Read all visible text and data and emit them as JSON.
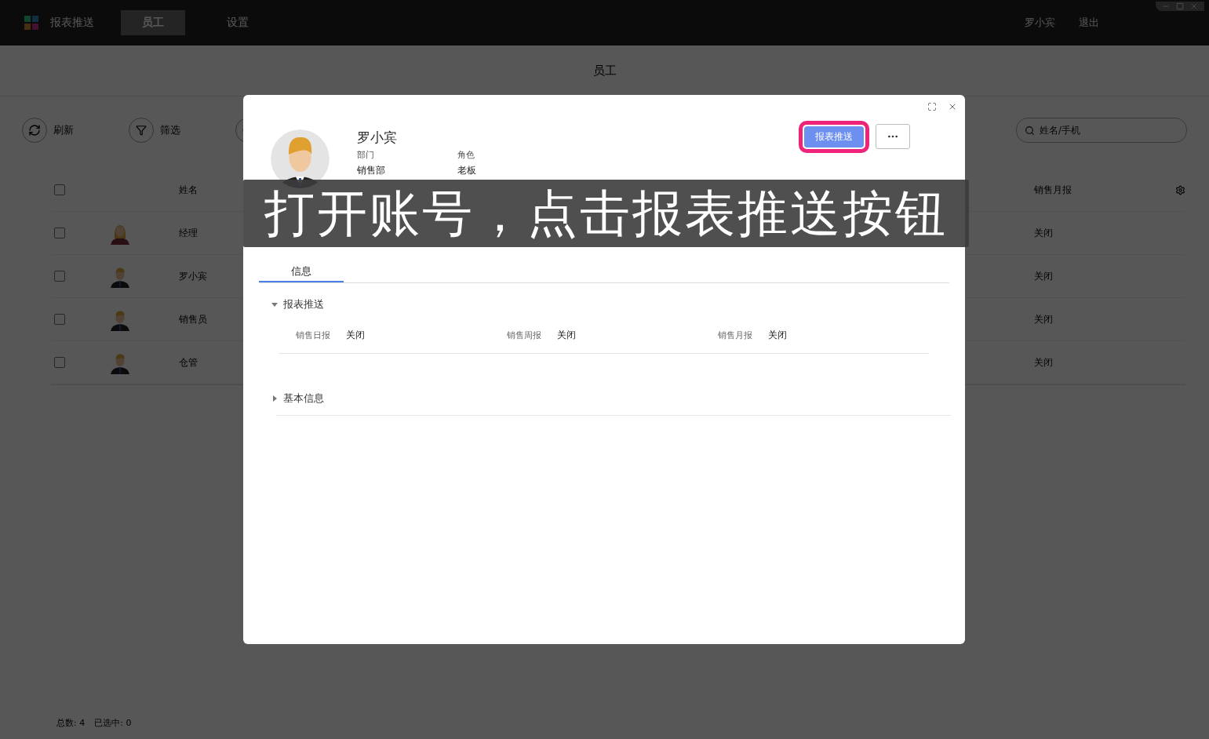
{
  "titlebar": {
    "app_name": "报表推送",
    "nav": [
      {
        "label": "员工",
        "selected": true
      },
      {
        "label": "设置",
        "selected": false
      }
    ],
    "user": "罗小宾",
    "logout": "退出"
  },
  "page_title": "员工",
  "toolbar": {
    "buttons": [
      {
        "label": "刷新",
        "kind": "refresh"
      },
      {
        "label": "筛选",
        "kind": "filter"
      }
    ],
    "search": {
      "placeholder": "姓名/手机"
    }
  },
  "table": {
    "columns": {
      "name": "姓名",
      "monthly": "销售月报"
    },
    "header_checked": false,
    "rows": [
      {
        "kind": "female",
        "name": "经理",
        "monthly": "关闭",
        "checked": false
      },
      {
        "kind": "male",
        "name": "罗小宾",
        "monthly": "关闭",
        "checked": false
      },
      {
        "kind": "male",
        "name": "销售员",
        "monthly": "关闭",
        "checked": false
      },
      {
        "kind": "male",
        "name": "仓管",
        "monthly": "关闭",
        "checked": false
      }
    ]
  },
  "status_bar": {
    "total_label": "总数:",
    "total": "4",
    "selected_label": "已选中:",
    "selected": "0"
  },
  "dialog": {
    "name": "罗小宾",
    "fields": [
      {
        "label": "部门",
        "value": "销售部"
      },
      {
        "label": "角色",
        "value": "老板"
      }
    ],
    "primary_button": "报表推送",
    "primary_highlighted": true,
    "tabs": [
      {
        "label": "信息",
        "selected": true
      }
    ],
    "sections": [
      {
        "title": "报表推送",
        "expanded": true,
        "items": [
          {
            "label": "销售日报",
            "value": "关闭"
          },
          {
            "label": "销售周报",
            "value": "关闭"
          },
          {
            "label": "销售月报",
            "value": "关闭"
          }
        ]
      },
      {
        "title": "基本信息",
        "expanded": false
      }
    ]
  },
  "caption": "打开账号，点击报表推送按钮"
}
